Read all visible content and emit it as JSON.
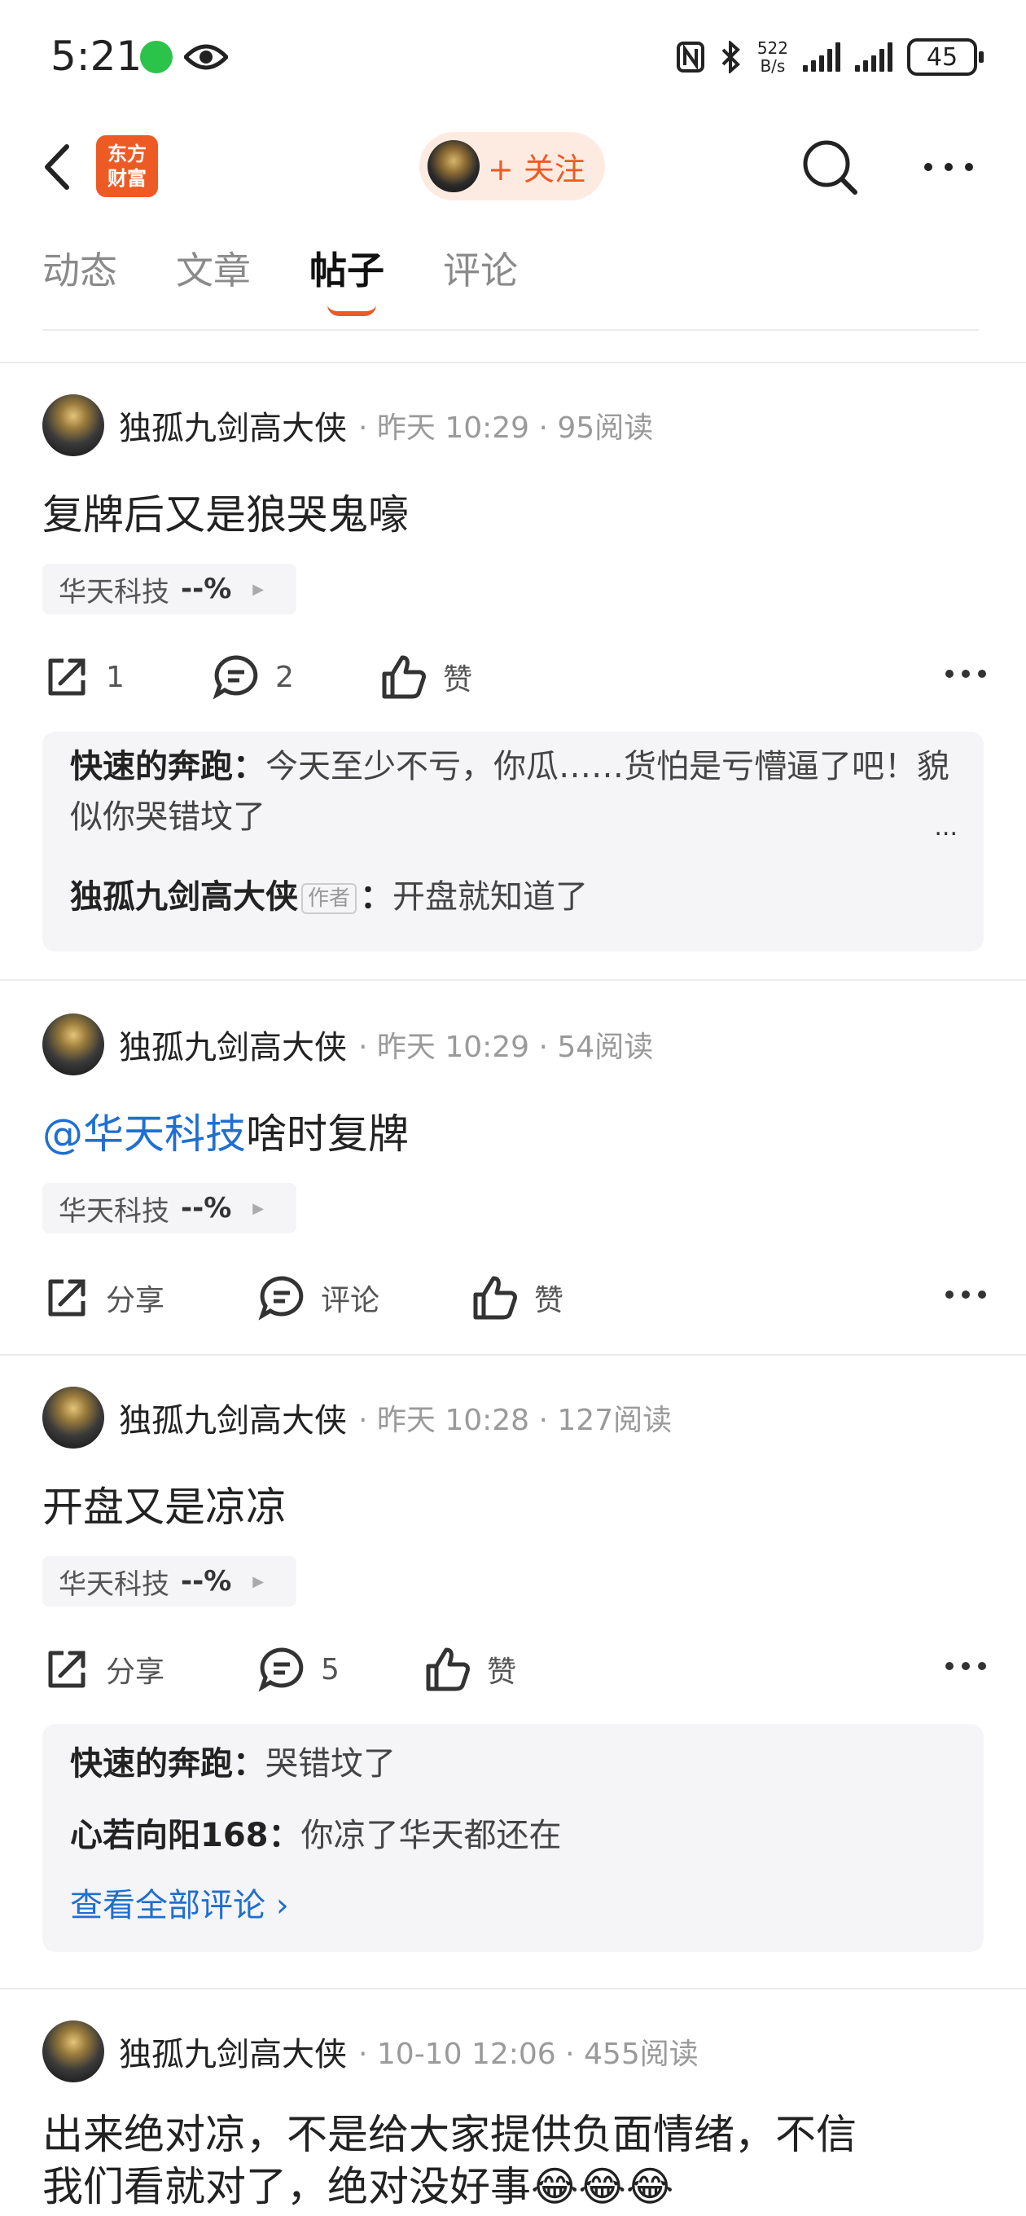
{
  "status_bar": {
    "time": "5:21",
    "net_speed_value": "522",
    "net_speed_unit": "B/s",
    "battery": "45"
  },
  "header": {
    "logo_line1": "东方",
    "logo_line2": "财富",
    "follow_label": "+ 关注"
  },
  "tabs": [
    {
      "label": "动态"
    },
    {
      "label": "文章"
    },
    {
      "label": "帖子"
    },
    {
      "label": "评论"
    }
  ],
  "posts": [
    {
      "author": "独孤九剑高大侠",
      "meta": "· 昨天 10:29 · 95阅读",
      "title": "复牌后又是狼哭鬼嚎",
      "stock": {
        "name": "华天科技",
        "pct": "--%"
      },
      "actions": {
        "share": "1",
        "comment": "2",
        "like": "赞"
      },
      "comments": [
        {
          "user": "快速的奔跑",
          "sep": "：",
          "text": "今天至少不亏，你瓜……货怕是亏懵逼了吧！貌似你哭错坟了"
        },
        {
          "user": "独孤九剑高大侠",
          "tag": "作者",
          "sep": "：",
          "text": "开盘就知道了"
        }
      ],
      "ellipsis": "..."
    },
    {
      "author": "独孤九剑高大侠",
      "meta": "· 昨天 10:29 · 54阅读",
      "mention": "@华天科技",
      "title": "啥时复牌",
      "stock": {
        "name": "华天科技",
        "pct": "--%"
      },
      "actions": {
        "share": "分享",
        "comment": "评论",
        "like": "赞"
      }
    },
    {
      "author": "独孤九剑高大侠",
      "meta": "· 昨天 10:28 · 127阅读",
      "title": "开盘又是凉凉",
      "stock": {
        "name": "华天科技",
        "pct": "--%"
      },
      "actions": {
        "share": "分享",
        "comment": "5",
        "like": "赞"
      },
      "comments": [
        {
          "user": "快速的奔跑",
          "sep": "：",
          "text": "哭错坟了"
        },
        {
          "user": "心若向阳168",
          "sep": "：",
          "text": "你凉了华天都还在"
        }
      ],
      "view_all": "查看全部评论 ›"
    },
    {
      "author": "独孤九剑高大侠",
      "meta": "· 10-10 12:06 · 455阅读",
      "title_line1": "出来绝对凉，不是给大家提供负面情绪，不信",
      "title_line2": "我们看就对了，绝对没好事😂😂😂"
    }
  ]
}
